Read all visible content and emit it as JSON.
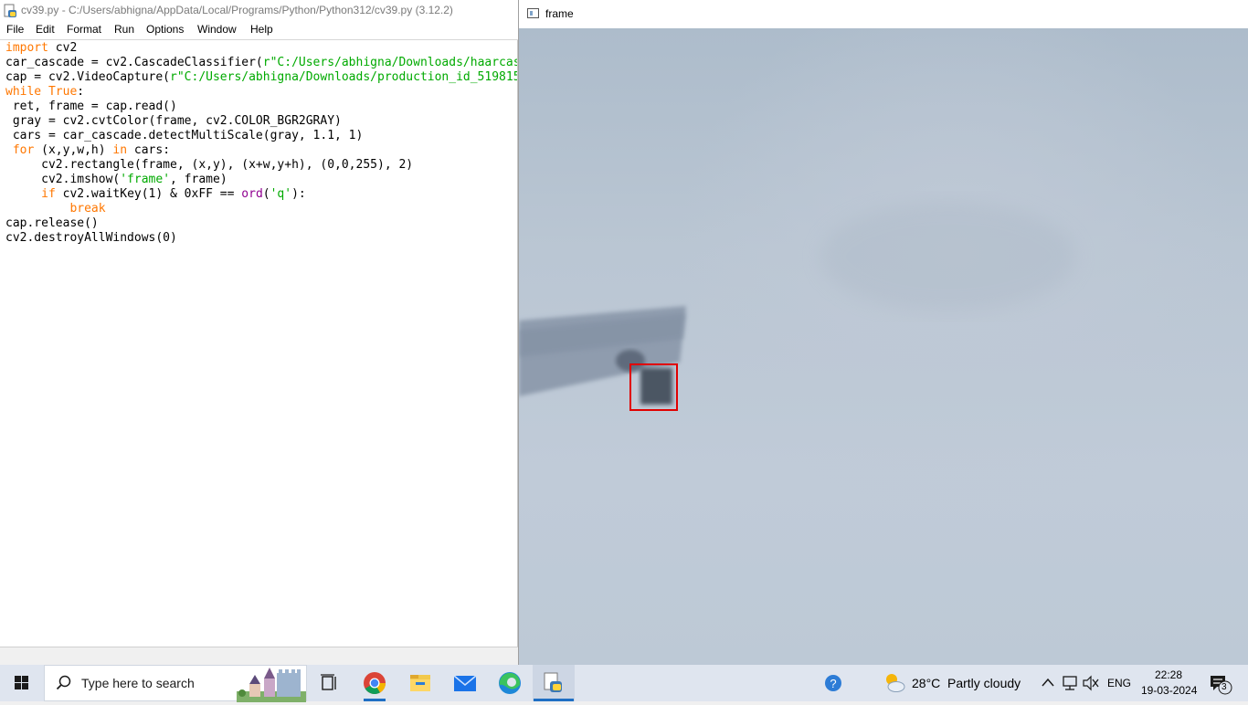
{
  "idle": {
    "title": "cv39.py - C:/Users/abhigna/AppData/Local/Programs/Python/Python312/cv39.py (3.12.2)",
    "menu": [
      "File",
      "Edit",
      "Format",
      "Run",
      "Options",
      "Window",
      "Help"
    ]
  },
  "frame_window": {
    "title": "frame"
  },
  "taskbar": {
    "search_placeholder": "Type here to search",
    "weather_temp": "28°C",
    "weather_desc": "Partly cloudy",
    "language": "ENG",
    "time": "22:28",
    "date": "19-03-2024",
    "notification_count": "3",
    "pinned_icons": [
      "task-view-icon",
      "chrome-icon",
      "file-explorer-icon",
      "mail-icon",
      "edge-icon",
      "python-idle-icon"
    ]
  },
  "colors": {
    "keyword": "#ff7700",
    "string": "#00aa00",
    "builtin": "#900090",
    "detection_box": "#e00000"
  }
}
